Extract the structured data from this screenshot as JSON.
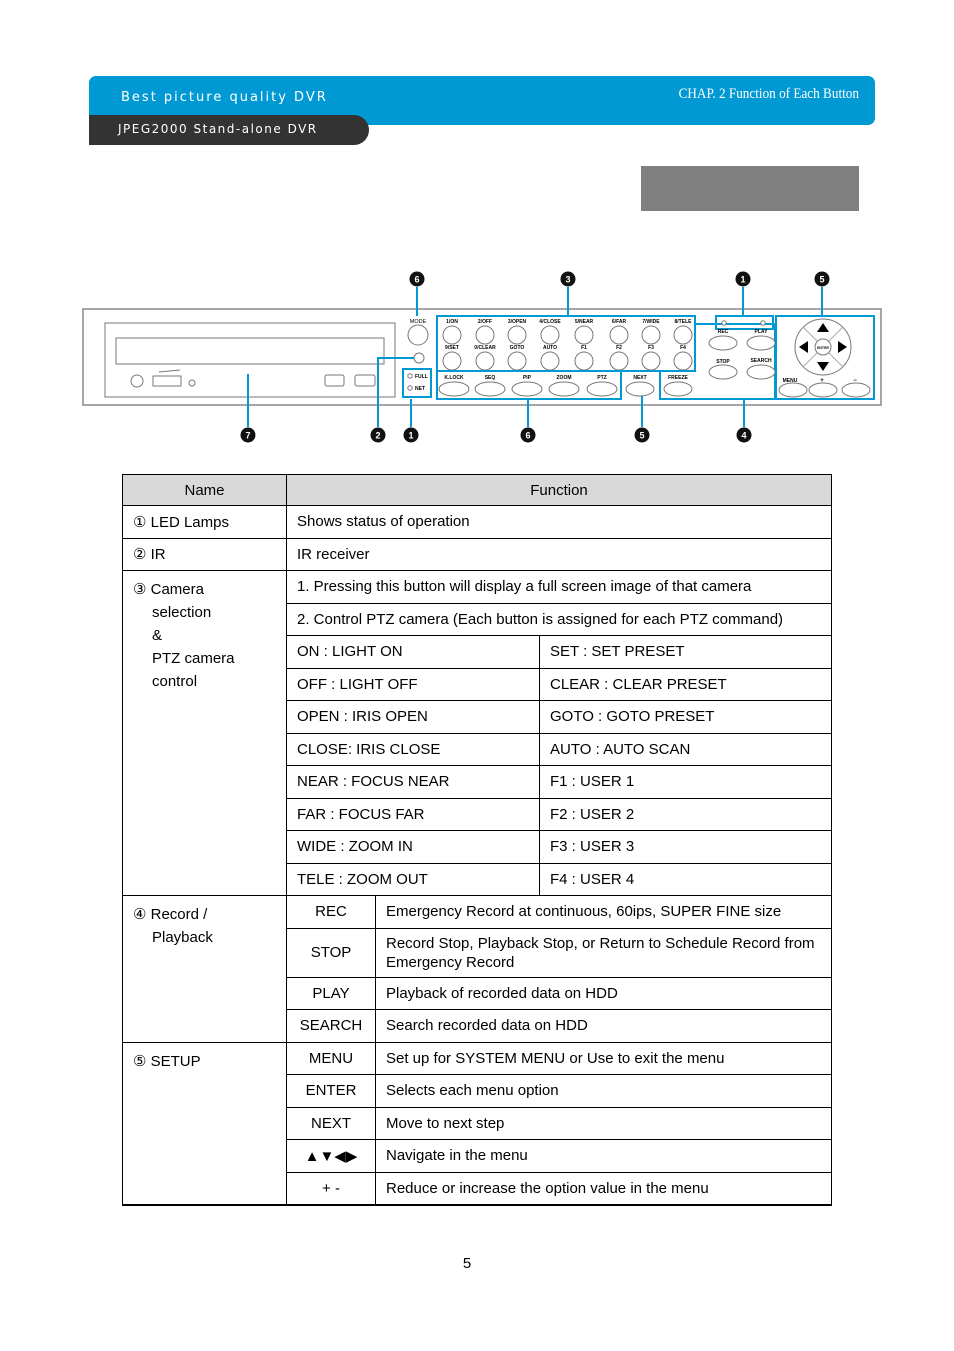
{
  "header": {
    "banner_title": "Best picture quality DVR",
    "sub_title": "JPEG2000 Stand-alone DVR",
    "chapter": "CHAP. 2   Function of Each Button",
    "brand_color": "#0099d4",
    "dark_color": "#333333"
  },
  "diagram": {
    "callouts_top": [
      "6",
      "3",
      "1",
      "5"
    ],
    "callouts_bottom": [
      "7",
      "2",
      "1",
      "6",
      "5",
      "4"
    ],
    "mode_label": "MODE",
    "led_labels": [
      "FULL",
      "NET"
    ],
    "camera_row1": [
      "1/ON",
      "2/OFF",
      "3/OPEN",
      "4/CLOSE",
      "5/NEAR",
      "6/FAR",
      "7/WIDE",
      "8/TELE"
    ],
    "camera_row2": [
      "9/SET",
      "0/CLEAR",
      "GOTO",
      "AUTO",
      "F1",
      "F2",
      "F3",
      "F4"
    ],
    "function_row": [
      "K.LOCK",
      "SEQ",
      "PIP",
      "ZOOM",
      "PTZ"
    ],
    "next_label": "NEXT",
    "freeze_label": "FREEZE",
    "record_labels": [
      "REC",
      "PLAY",
      "STOP",
      "SEARCH"
    ],
    "enter_label": "ENTER",
    "setup_labels": [
      "MENU",
      "+",
      "−"
    ]
  },
  "table": {
    "headers": [
      "Name",
      "Function"
    ],
    "led": {
      "name": "① LED Lamps",
      "function": "Shows status of operation"
    },
    "ir": {
      "name": "② IR",
      "function": "IR receiver"
    },
    "camera": {
      "name_lines": [
        "③ Camera",
        "selection",
        "&",
        "PTZ camera",
        "control"
      ],
      "desc1": "1. Pressing this button will display a full screen image of that camera",
      "desc2": "2. Control PTZ camera (Each button is assigned for each PTZ command)",
      "pairs": [
        [
          "ON : LIGHT ON",
          "SET : SET PRESET"
        ],
        [
          "OFF : LIGHT OFF",
          "CLEAR : CLEAR PRESET"
        ],
        [
          "OPEN : IRIS OPEN",
          "GOTO : GOTO PRESET"
        ],
        [
          "CLOSE: IRIS CLOSE",
          "AUTO : AUTO SCAN"
        ],
        [
          "NEAR : FOCUS NEAR",
          "F1 : USER 1"
        ],
        [
          "FAR : FOCUS FAR",
          "F2 : USER 2"
        ],
        [
          "WIDE : ZOOM IN",
          "F3 : USER 3"
        ],
        [
          "TELE : ZOOM OUT",
          "F4 : USER 4"
        ]
      ]
    },
    "record": {
      "name_lines": [
        "④ Record /",
        "Playback"
      ],
      "rows": [
        {
          "key": "REC",
          "desc": "Emergency Record at continuous, 60ips, SUPER FINE size"
        },
        {
          "key": "STOP",
          "desc": "Record Stop, Playback Stop, or Return to Schedule Record from Emergency Record"
        },
        {
          "key": "PLAY",
          "desc": "Playback of recorded data on HDD"
        },
        {
          "key": "SEARCH",
          "desc": "Search recorded data on HDD"
        }
      ]
    },
    "setup": {
      "name": "⑤ SETUP",
      "rows": [
        {
          "key": "MENU",
          "desc": "Set up for SYSTEM MENU or Use to exit the menu"
        },
        {
          "key": "ENTER",
          "desc": "Selects each menu option"
        },
        {
          "key": "NEXT",
          "desc": "Move to next step"
        },
        {
          "key": "▲▼◀▶",
          "desc": "Navigate in the menu"
        },
        {
          "key": "+ -",
          "desc": "Reduce or increase the option value in the menu"
        }
      ]
    }
  },
  "page_number": "5"
}
